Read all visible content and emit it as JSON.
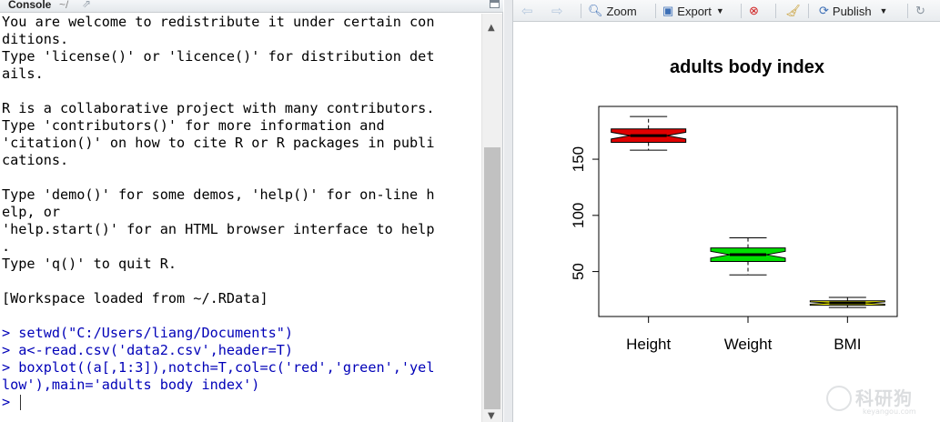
{
  "console": {
    "title": "Console",
    "path": "~/",
    "lines": [
      {
        "text": "You are welcome to redistribute it under certain con",
        "kind": "out"
      },
      {
        "text": "ditions.",
        "kind": "out"
      },
      {
        "text": "Type 'license()' or 'licence()' for distribution det",
        "kind": "out"
      },
      {
        "text": "ails.",
        "kind": "out"
      },
      {
        "text": "",
        "kind": "out"
      },
      {
        "text": "R is a collaborative project with many contributors.",
        "kind": "out"
      },
      {
        "text": "Type 'contributors()' for more information and",
        "kind": "out"
      },
      {
        "text": "'citation()' on how to cite R or R packages in publi",
        "kind": "out"
      },
      {
        "text": "cations.",
        "kind": "out"
      },
      {
        "text": "",
        "kind": "out"
      },
      {
        "text": "Type 'demo()' for some demos, 'help()' for on-line h",
        "kind": "out"
      },
      {
        "text": "elp, or",
        "kind": "out"
      },
      {
        "text": "'help.start()' for an HTML browser interface to help",
        "kind": "out"
      },
      {
        "text": ".",
        "kind": "out"
      },
      {
        "text": "Type 'q()' to quit R.",
        "kind": "out"
      },
      {
        "text": "",
        "kind": "out"
      },
      {
        "text": "[Workspace loaded from ~/.RData]",
        "kind": "out"
      },
      {
        "text": "",
        "kind": "out"
      },
      {
        "text": "> setwd(\"C:/Users/liang/Documents\")",
        "kind": "cmd"
      },
      {
        "text": "> a<-read.csv('data2.csv',header=T)",
        "kind": "cmd"
      },
      {
        "text": "> boxplot((a[,1:3]),notch=T,col=c('red','green','yel",
        "kind": "cmd"
      },
      {
        "text": "low'),main='adults body index')",
        "kind": "cmd"
      }
    ],
    "prompt": ">"
  },
  "toolbar": {
    "zoom": "Zoom",
    "export": "Export",
    "publish": "Publish"
  },
  "watermark": {
    "name": "科研狗",
    "url": "keyangou.com"
  },
  "chart_data": {
    "type": "boxplot",
    "title": "adults body index",
    "categories": [
      "Height",
      "Weight",
      "BMI"
    ],
    "colors": [
      "#e00000",
      "#00e000",
      "#ffff00"
    ],
    "notch": true,
    "yticks": [
      50,
      100,
      150
    ],
    "ylim": [
      10,
      197
    ],
    "boxes": [
      {
        "name": "Height",
        "whisker_low": 158,
        "q1": 165,
        "median": 171,
        "q3": 177,
        "whisker_high": 188,
        "notch_low": 168,
        "notch_high": 174
      },
      {
        "name": "Weight",
        "whisker_low": 47,
        "q1": 59,
        "median": 65,
        "q3": 71,
        "whisker_high": 80,
        "notch_low": 62,
        "notch_high": 68
      },
      {
        "name": "BMI",
        "whisker_low": 18,
        "q1": 20,
        "median": 22,
        "q3": 24,
        "whisker_high": 27,
        "notch_low": 21,
        "notch_high": 23
      }
    ]
  }
}
